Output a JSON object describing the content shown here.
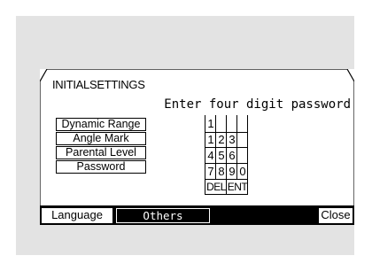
{
  "osd": {
    "title": "INITIALSETTINGS",
    "prompt": "Enter four digit password"
  },
  "menu": {
    "items": [
      {
        "label": "Dynamic Range"
      },
      {
        "label": "Angle Mark"
      },
      {
        "label": "Parental Level"
      },
      {
        "label": "Password"
      }
    ]
  },
  "password_entry": {
    "digits": [
      "1",
      "",
      "",
      ""
    ]
  },
  "keypad": {
    "rows": [
      [
        "1",
        "2",
        "3"
      ],
      [
        "4",
        "5",
        "6"
      ],
      [
        "7",
        "8",
        "9",
        "0"
      ]
    ],
    "del_label": "DEL",
    "ent_label": "ENT"
  },
  "bottom_bar": {
    "language_label": "Language",
    "others_label": "Others",
    "close_label": "Close"
  }
}
